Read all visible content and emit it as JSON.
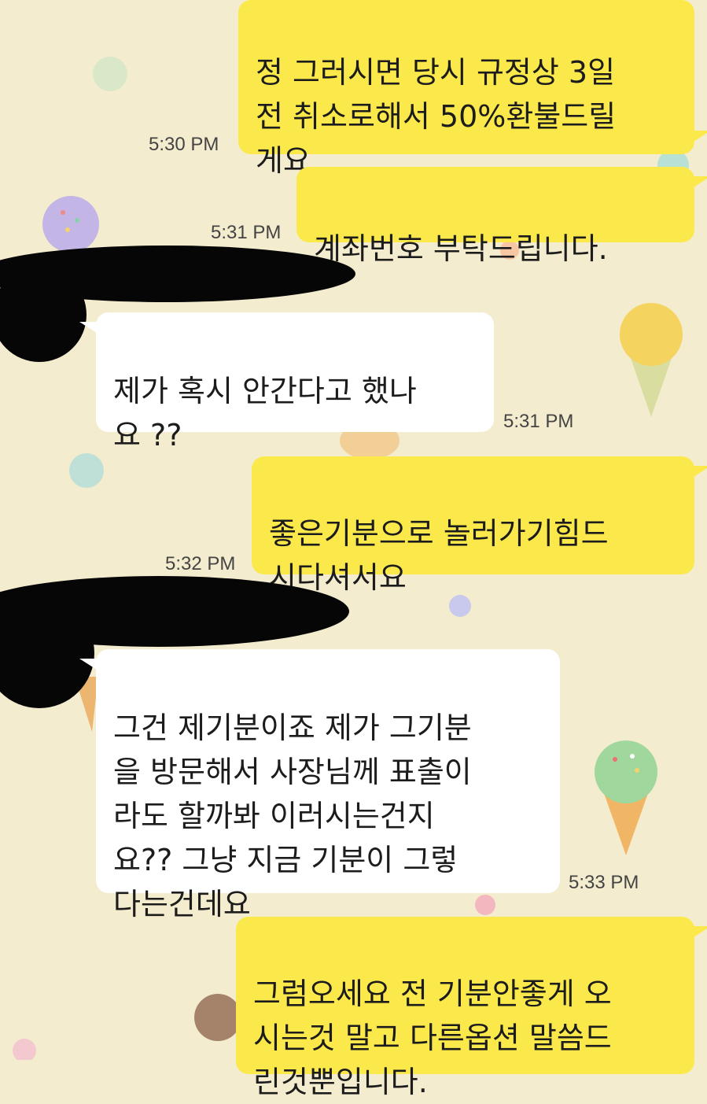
{
  "messages": [
    {
      "sender": "me",
      "text": "정 그러시면 당시 규정상 3일\n전 취소로해서 50%환불드릴\n게요",
      "time": "5:30 PM"
    },
    {
      "sender": "me",
      "text": "계좌번호 부탁드립니다.",
      "time": "5:31 PM"
    },
    {
      "sender": "them",
      "text": "제가 혹시 안간다고 했나\n요 ??",
      "time": "5:31 PM"
    },
    {
      "sender": "me",
      "text": "좋은기분으로 놀러가기힘드\n시다셔서요",
      "time": "5:32 PM"
    },
    {
      "sender": "them",
      "text": "그건 제기분이죠 제가 그기분\n을 방문해서 사장님께 표출이\n라도 할까봐 이러시는건지\n요??  그냥 지금 기분이 그렇\n다는건데요",
      "time": "5:33 PM"
    },
    {
      "sender": "me",
      "text": "그럼오세요 전 기분안좋게 오\n시는것 말고 다른옵션 말씀드\n린것뿐입니다.",
      "time": ""
    }
  ],
  "colors": {
    "background": "#f4eccf",
    "my_bubble": "#fbe94c",
    "their_bubble": "#ffffff",
    "redaction": "#060606"
  },
  "icons": [
    "ice-cream-cone-icon",
    "polka-dot-icon"
  ]
}
